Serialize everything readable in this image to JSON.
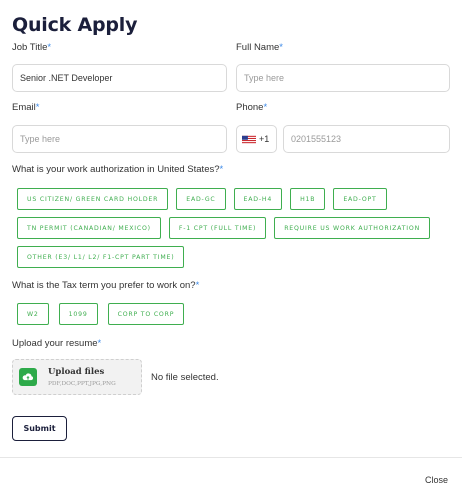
{
  "title": "Quick Apply",
  "required_marker": "*",
  "job_title": {
    "label": "Job Title",
    "value": "Senior .NET Developer"
  },
  "full_name": {
    "label": "Full Name",
    "placeholder": "Type here"
  },
  "email": {
    "label": "Email",
    "placeholder": "Type here"
  },
  "phone": {
    "label": "Phone",
    "country_flag_icon": "us-flag-icon",
    "dial_code": "+1",
    "placeholder": "0201555123"
  },
  "work_auth": {
    "question": "What is your work authorization in United States?",
    "options": [
      "US CITIZEN/ GREEN CARD HOLDER",
      "EAD-GC",
      "EAD-H4",
      "H1B",
      "EAD-OPT",
      "TN PERMIT (CANADIAN/ MEXICO)",
      "F-1 CPT (FULL TIME)",
      "REQUIRE US WORK AUTHORIZATION",
      "OTHER (E3/ L1/ L2/ F1-CPT PART TIME)"
    ]
  },
  "tax_term": {
    "question": "What is the Tax term you prefer to work on?",
    "options": [
      "W2",
      "1099",
      "CORP TO CORP"
    ]
  },
  "resume": {
    "label": "Upload your resume",
    "upload_icon": "cloud-upload-icon",
    "upload_title": "Upload files",
    "upload_formats": "PDF,DOC,PPT,JPG,PNG",
    "status": "No file selected."
  },
  "submit_label": "Submit",
  "close_label": "Close",
  "colors": {
    "title": "#1b1f3b",
    "required": "#3c8ae8",
    "chip": "#3fae4f",
    "upload_icon": "#2eaa4a"
  }
}
